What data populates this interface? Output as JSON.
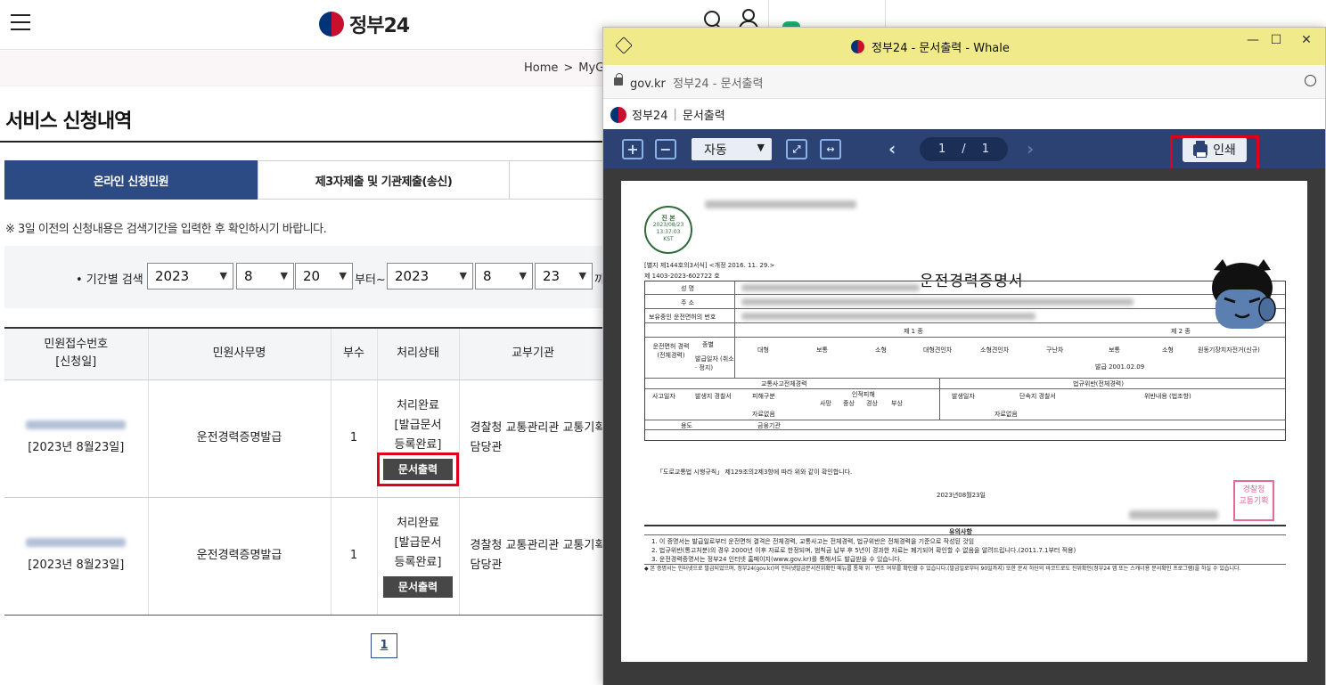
{
  "site": {
    "logo_text": "정부24",
    "breadcrumb": [
      "Home",
      ">",
      "MyGOV"
    ],
    "page_title": "서비스 신청내역",
    "tabs": [
      "온라인 신청민원",
      "제3자제출 및 기관제출(송신)"
    ],
    "notice": "※ 3일 이전의 신청내용은 검색기간을 입력한 후 확인하시기 바랍니다.",
    "filter": {
      "label": "• 기간별 검색",
      "from_year": "2023",
      "from_month": "8",
      "from_day": "20",
      "from_suffix": "부터~",
      "to_year": "2023",
      "to_month": "8",
      "to_day": "23",
      "to_suffix": "까"
    },
    "table": {
      "headers": [
        "민원접수번호\n[신청일]",
        "민원사무명",
        "부수",
        "처리상태",
        "교부기관"
      ],
      "rows": [
        {
          "date": "[2023년 8월23일]",
          "name": "운전경력증명발급",
          "copies": "1",
          "status": "처리완료\n[발급문서\n등록완료]",
          "button": "문서출력",
          "org": "경찰청 교통관리관 교통기획\n담당관"
        },
        {
          "date": "[2023년 8월23일]",
          "name": "운전경력증명발급",
          "copies": "1",
          "status": "처리완료\n[발급문서\n등록완료]",
          "button": "문서출력",
          "org": "경찰청 교통관리관 교통기획\n담당관"
        }
      ]
    },
    "pagination": [
      "1"
    ]
  },
  "popup": {
    "window_title": "정부24 - 문서출력 - Whale",
    "window_controls": [
      "—",
      "☐",
      "✕"
    ],
    "address_domain": "gov.kr",
    "address_title": "정부24 - 문서출력",
    "doc_header_brand": "정부24",
    "doc_header_sep": "|",
    "doc_header_title": "문서출력",
    "toolbar": {
      "zoom_in": "+",
      "zoom_out": "−",
      "zoom_mode": "자동",
      "page_current": "1",
      "page_sep": "/",
      "page_total": "1",
      "print_label": "인쇄"
    },
    "document": {
      "stamp_lines": [
        "진 본",
        "2023/08/23",
        "13:37:03",
        "KST"
      ],
      "form_line": "[별지 제144호의3서식] <개정 2016. 11. 29.>",
      "doc_no": "제 1403-2023-602722 호",
      "title": "운전경력증명서",
      "fields": [
        "성 명",
        "주 소",
        "보유중인 운전면허의 번호"
      ],
      "license_headers": [
        "제 1 종",
        "제 2 종"
      ],
      "license_cols": [
        "대형",
        "보통",
        "소형",
        "대형견인차",
        "소형견인차",
        "구난차",
        "보통",
        "소형",
        "원동기장치자전거(신규)"
      ],
      "license_side": [
        "운전면허 경력 (전체경력)",
        "종별",
        "발급일자 (취소 · 정지)"
      ],
      "issue_date": "발급 2001.02.09",
      "accident_header": "교통사고전체경력",
      "violation_header": "법규위반(전체경력)",
      "accident_cols": [
        "사고일자",
        "발생지 경찰서",
        "피해구분",
        "인적피해",
        "사망",
        "중상",
        "경상",
        "부상"
      ],
      "violation_cols": [
        "발생일자",
        "단속지 경찰서",
        "위반내용 (법조항)"
      ],
      "no_record": "자료없음",
      "purpose_label": "용도",
      "purpose_value": "금융기관",
      "certify": "「도로교통법 시행규칙」 제129조의2제3항에 따라 위와 같이 확인합니다.",
      "date": "2023년08월23일",
      "seal_text": "경찰청\n교통기획",
      "notes_title": "유의사항",
      "notes": [
        "1. 이 증명서는 발급일로부터 운전면허 결격은 전체경력, 교통사고는 전체경력, 법규위반은 전체경력을 기준으로 작성된 것임",
        "2. 법규위반(통고처분)의 경우 2000년 이후 자료로 한정되며, 범칙금 납부 후 5년이 경과한 자료는 폐기되어 확인할 수 없음을 알려드립니다.(2011.7.1부터 적용)",
        "3. 운전경력증명서는 정부24 인터넷 홈페이지(www.gov.kr)를 통해서도 발급받을 수 있습니다."
      ],
      "footer_note": "◆ 본 증명서는 인터넷으로 발급되었으며, 정부24(gov.kr)의 인터넷발급문서진위확인 메뉴를 통해 위 · 변조 여부를 확인할 수 있습니다.(발급일로부터 90일까지) 또한 문서 하단의 바코드로도 진위확인(정부24 앱 또는 스캐너용 문서확인 프로그램)을 하실 수 있습니다."
    }
  },
  "colors": {
    "brand_navy": "#2c4a84",
    "toolbar_navy": "#2b4272",
    "titlebar_yellow": "#f1ea8a",
    "highlight_red": "#e0001b"
  }
}
